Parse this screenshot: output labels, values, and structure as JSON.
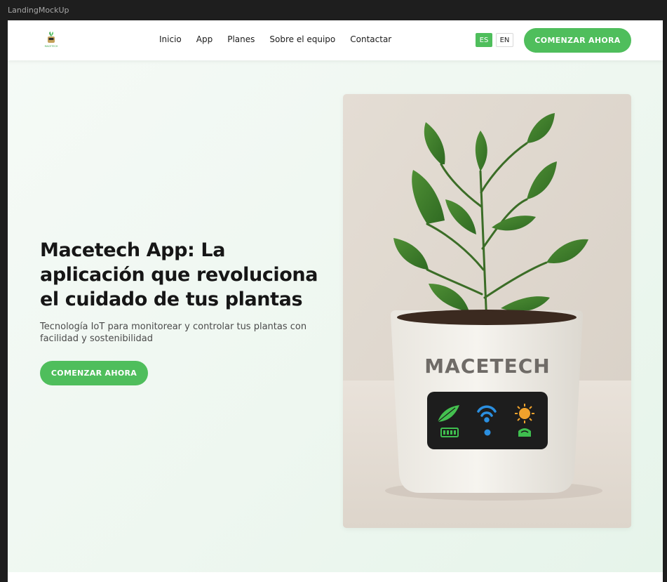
{
  "window": {
    "title": "LandingMockUp"
  },
  "nav": {
    "logo_text": "MACETECH",
    "links": [
      "Inicio",
      "App",
      "Planes",
      "Sobre el equipo",
      "Contactar"
    ],
    "lang_es": "ES",
    "lang_en": "EN",
    "active_lang": "ES",
    "cta": "COMENZAR AHORA"
  },
  "hero": {
    "title": "Macetech App: La aplicación que revoluciona el cuidado de tus plantas",
    "subtitle": "Tecnología IoT para monitorear y controlar tus plantas con facilidad y sostenibilidad",
    "cta": "COMENZAR AHORA",
    "image": {
      "pot_label": "MACETECH",
      "display_icons": [
        "leaf-icon",
        "wifi-icon",
        "sun-icon",
        "battery-icon",
        "dot-icon",
        "moisture-icon"
      ]
    }
  },
  "colors": {
    "accent": "#4fbe5c",
    "title": "#161616",
    "hero_bg": "#eef7f0"
  }
}
